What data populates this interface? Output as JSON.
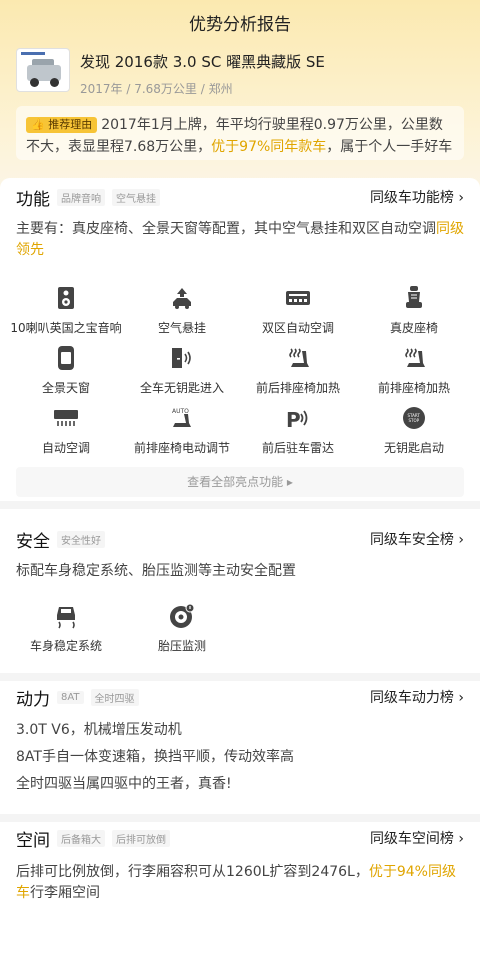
{
  "header": {
    "title": "优势分析报告"
  },
  "car": {
    "name": "发现 2016款 3.0 SC 曜黑典藏版 SE",
    "meta": "2017年 / 7.68万公里 / 郑州"
  },
  "reason": {
    "tag": "推荐理由",
    "text_before": "2017年1月上牌，年平均行驶里程0.97万公里，公里数不大，表显里程7.68万公里，",
    "highlight": "优于97%同年款车",
    "text_after": "，属于个人一手好车"
  },
  "function": {
    "title": "功能",
    "tags": [
      "品牌音响",
      "空气悬挂"
    ],
    "rank": "同级车功能榜 ›",
    "desc_before": "主要有：真皮座椅、全景天窗等配置，其中空气悬挂和双区自动空调",
    "desc_highlight": "同级领先",
    "features": [
      {
        "label": "10喇叭英国之宝音响",
        "icon": "speaker-icon"
      },
      {
        "label": "空气悬挂",
        "icon": "air-suspension-icon"
      },
      {
        "label": "双区自动空调",
        "icon": "dual-ac-icon"
      },
      {
        "label": "真皮座椅",
        "icon": "leather-seat-icon"
      },
      {
        "label": "全景天窗",
        "icon": "sunroof-icon"
      },
      {
        "label": "全车无钥匙进入",
        "icon": "keyless-entry-icon"
      },
      {
        "label": "前后排座椅加热",
        "icon": "seat-heat-icon"
      },
      {
        "label": "前排座椅加热",
        "icon": "seat-heat-icon"
      },
      {
        "label": "自动空调",
        "icon": "auto-ac-icon"
      },
      {
        "label": "前排座椅电动调节",
        "icon": "power-seat-icon"
      },
      {
        "label": "前后驻车雷达",
        "icon": "parking-radar-icon"
      },
      {
        "label": "无钥匙启动",
        "icon": "keyless-start-icon"
      }
    ],
    "more": "查看全部亮点功能 ▸"
  },
  "safety": {
    "title": "安全",
    "tags": [
      "安全性好"
    ],
    "rank": "同级车安全榜 ›",
    "desc": "标配车身稳定系统、胎压监测等主动安全配置",
    "features": [
      {
        "label": "车身稳定系统",
        "icon": "stability-icon"
      },
      {
        "label": "胎压监测",
        "icon": "tire-pressure-icon"
      }
    ]
  },
  "power": {
    "title": "动力",
    "tags": [
      "8AT",
      "全时四驱"
    ],
    "rank": "同级车动力榜 ›",
    "lines": [
      "3.0T V6，机械增压发动机",
      "8AT手自一体变速箱，换挡平顺，传动效率高",
      "全时四驱当属四驱中的王者，真香!"
    ]
  },
  "space": {
    "title": "空间",
    "tags": [
      "后备箱大",
      "后排可放倒"
    ],
    "rank": "同级车空间榜 ›",
    "desc_before": "后排可比例放倒，行李厢容积可从1260L扩容到2476L，",
    "desc_highlight": "优于94%同级车",
    "desc_after": "行李厢空间"
  },
  "colors": {
    "accent": "#e0a500",
    "tag_bg": "#f7c436",
    "top_bg": "#fbe9b0"
  }
}
